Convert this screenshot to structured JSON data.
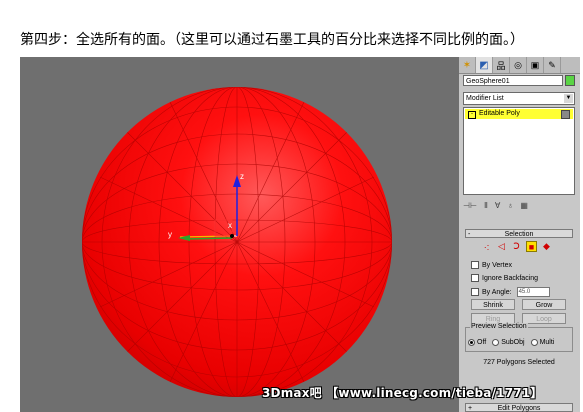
{
  "caption": "第四步：全选所有的面。（这里可以通过石墨工具的百分比来选择不同比例的面。）",
  "viewport": {
    "axis_x_label": "x",
    "axis_y_label": "y",
    "axis_z_label": "z"
  },
  "panel": {
    "tabs": [
      "create-icon",
      "modify-icon",
      "hierarchy-icon",
      "motion-icon",
      "display-icon",
      "utilities-icon"
    ],
    "object_name": "GeoSphere01",
    "object_color": "#5ad445",
    "modifier_list_label": "Modifier List",
    "stack_item": "Editable Poly",
    "selection_title": "Selection",
    "by_vertex": "By Vertex",
    "ignore_backfacing": "Ignore Backfacing",
    "by_angle": "By Angle:",
    "angle_value": "45.0",
    "shrink": "Shrink",
    "grow": "Grow",
    "ring": "Ring",
    "loop": "Loop",
    "preview_title": "Preview Selection",
    "preview_off": "Off",
    "preview_subobj": "SubObj",
    "preview_multi": "Multi",
    "status": "727 Polygons Selected",
    "edit_polygons": "Edit Polygons"
  },
  "watermark": "3Dmax吧 【www.linecg.com/tieba/1771】",
  "colors": {
    "sphere": "#ff0000",
    "viewport_bg": "#6f6f6f",
    "stack_highlight": "#ffff33"
  }
}
